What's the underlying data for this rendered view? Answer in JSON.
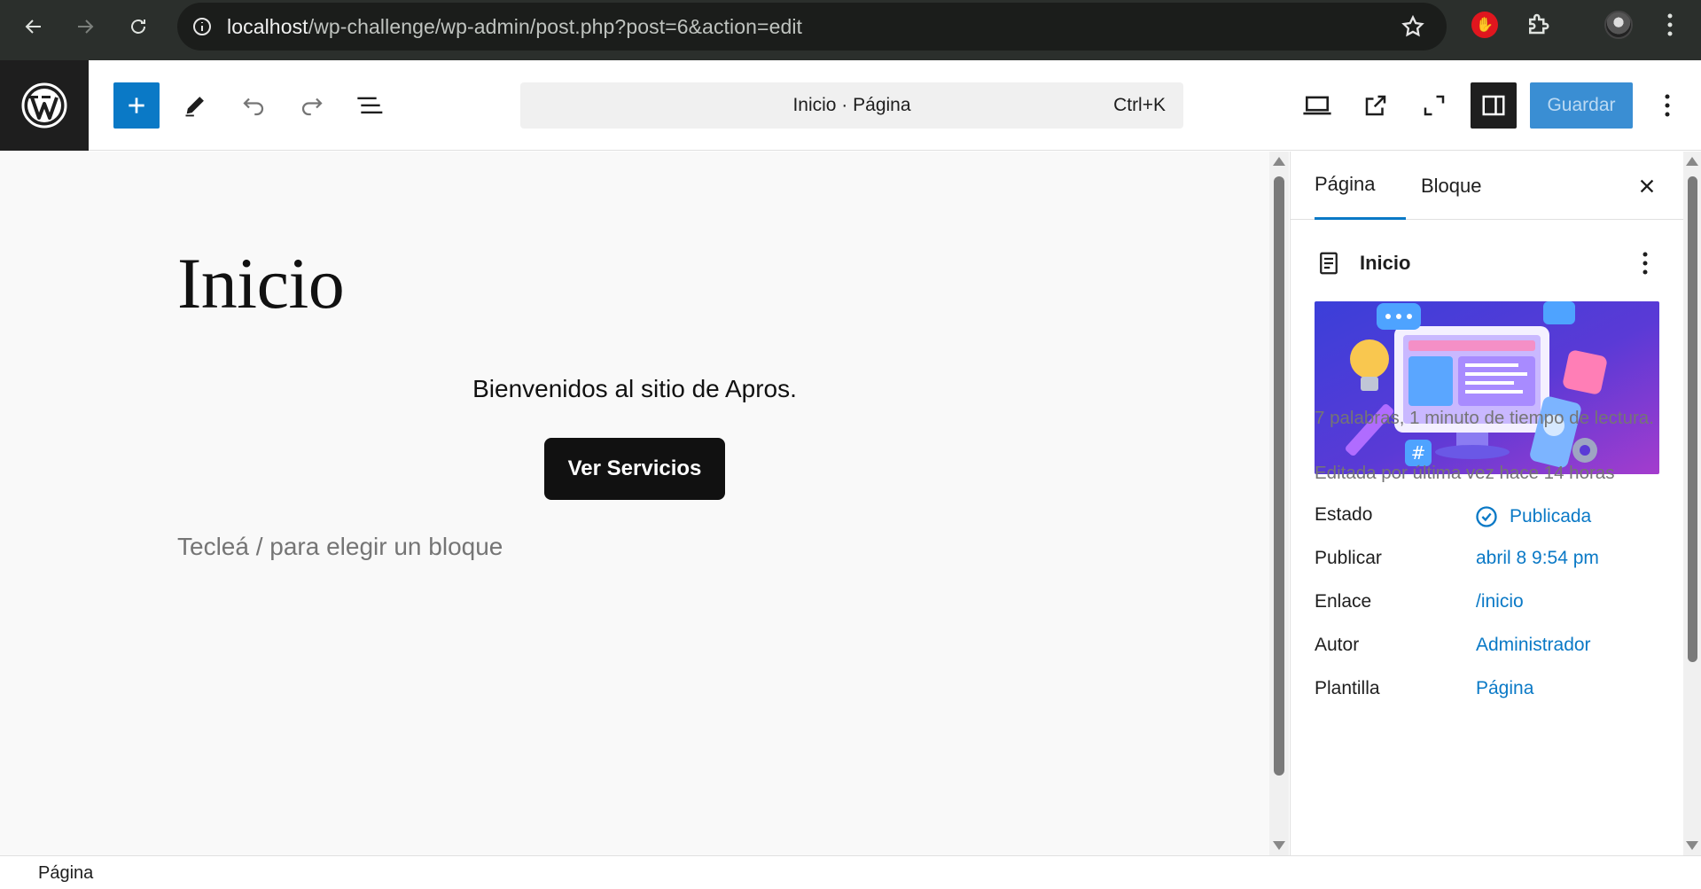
{
  "browser": {
    "url_host": "localhost",
    "url_path": "/wp-challenge/wp-admin/post.php?post=6&action=edit"
  },
  "header": {
    "command_bar": "Inicio · Página",
    "command_shortcut": "Ctrl+K",
    "save_label": "Guardar"
  },
  "canvas": {
    "title": "Inicio",
    "paragraph": "Bienvenidos al sitio de Apros.",
    "button_label": "Ver Servicios",
    "appender_placeholder": "Tecleá / para elegir un bloque"
  },
  "sidebar": {
    "tabs": [
      {
        "label": "Página"
      },
      {
        "label": "Bloque"
      }
    ],
    "document_title": "Inicio",
    "word_count": "7 palabras, 1 minuto de tiempo de lectura.",
    "last_edited": "Editada por última vez hace 14 horas",
    "properties": [
      {
        "key": "Estado",
        "value": "Publicada"
      },
      {
        "key": "Publicar",
        "value": "abril 8 9:54 pm"
      },
      {
        "key": "Enlace",
        "value": "/inicio"
      },
      {
        "key": "Autor",
        "value": "Administrador"
      },
      {
        "key": "Plantilla",
        "value": "Página"
      }
    ]
  },
  "footer": {
    "breadcrumb": "Página"
  },
  "colors": {
    "accent": "#0a79c6",
    "chrome_bg": "#2b2f2c",
    "dark": "#1e1e1e"
  }
}
